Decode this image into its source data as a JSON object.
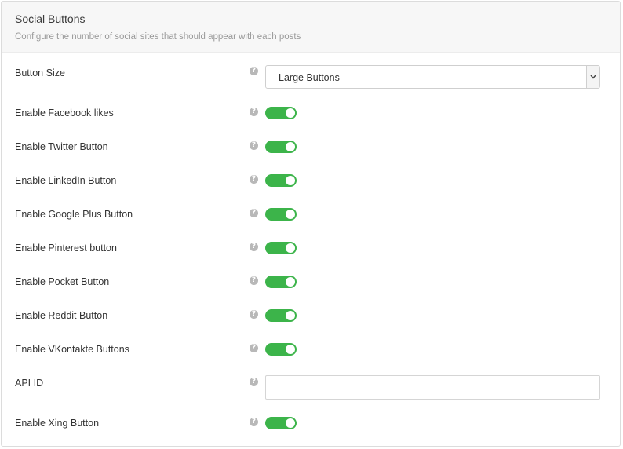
{
  "header": {
    "title": "Social Buttons",
    "description": "Configure the number of social sites that should appear with each posts"
  },
  "help_glyph": "?",
  "settings": {
    "button_size": {
      "label": "Button Size",
      "value": "Large Buttons"
    },
    "facebook": {
      "label": "Enable Facebook likes",
      "enabled": true
    },
    "twitter": {
      "label": "Enable Twitter Button",
      "enabled": true
    },
    "linkedin": {
      "label": "Enable LinkedIn Button",
      "enabled": true
    },
    "google_plus": {
      "label": "Enable Google Plus Button",
      "enabled": true
    },
    "pinterest": {
      "label": "Enable Pinterest button",
      "enabled": true
    },
    "pocket": {
      "label": "Enable Pocket Button",
      "enabled": true
    },
    "reddit": {
      "label": "Enable Reddit Button",
      "enabled": true
    },
    "vkontakte": {
      "label": "Enable VKontakte Buttons",
      "enabled": true
    },
    "api_id": {
      "label": "API ID",
      "value": "",
      "placeholder": ""
    },
    "xing": {
      "label": "Enable Xing Button",
      "enabled": true
    }
  },
  "colors": {
    "toggle_on": "#3cb44a",
    "help_icon": "#b8b8b8",
    "header_bg": "#f7f7f7"
  },
  "icons": {
    "help": "question-circle-icon",
    "dropdown": "chevron-down-icon"
  }
}
